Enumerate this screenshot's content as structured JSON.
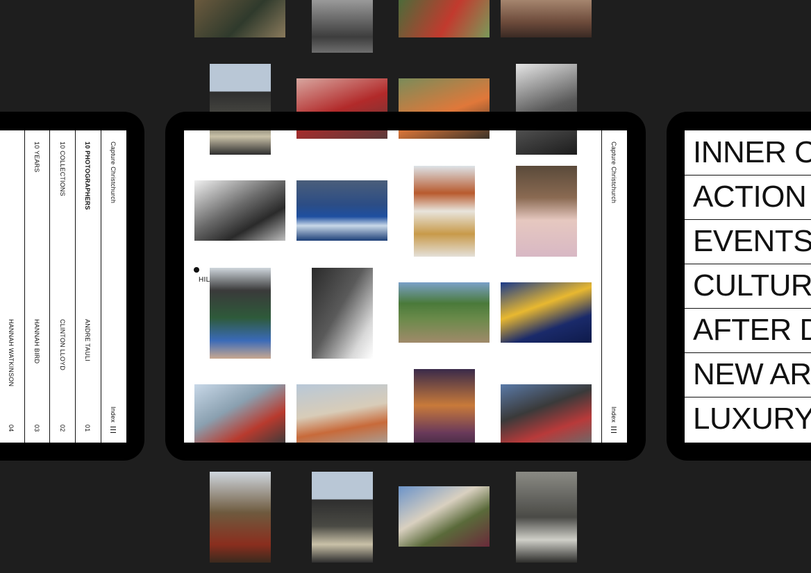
{
  "left_tablet": {
    "brand": "Capture Christchurch",
    "index_label": "Index",
    "columns": [
      {
        "title": "10 PHOTOGRAPHERS",
        "name": "ANDRE TAULI",
        "number": "01"
      },
      {
        "title": "10 COLLECTIONS",
        "name": "CLINTON LLOYD",
        "number": "02"
      },
      {
        "title": "10 YEARS",
        "name": "HANNAH BIRD",
        "number": "03"
      },
      {
        "title": "",
        "name": "HANNAH WATKINSON",
        "number": "04"
      }
    ]
  },
  "center_tablet": {
    "brand": "Capture Christchurch",
    "index_label": "Index",
    "hover_label": "HILLARY MCOSCAR"
  },
  "right_tablet": {
    "menu": [
      "INNER C",
      "ACTION",
      "EVENTS",
      "CULTUR",
      "AFTER D",
      "NEW AR",
      "LUXURY"
    ]
  },
  "colors": {
    "background": "#1e1e1e",
    "frame": "#000000",
    "screen": "#ffffff",
    "ink": "#111111"
  }
}
